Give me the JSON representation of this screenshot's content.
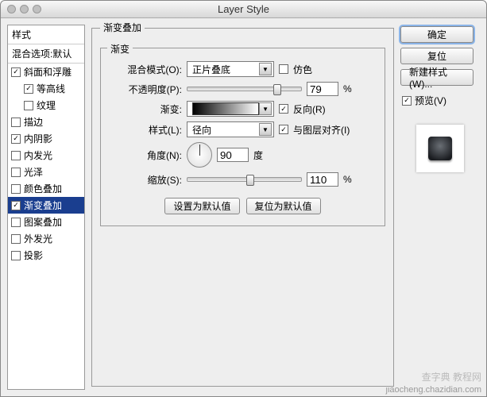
{
  "window": {
    "title": "Layer Style"
  },
  "left": {
    "header1": "样式",
    "header2": "混合选项:默认",
    "items": [
      {
        "label": "斜面和浮雕",
        "checked": true,
        "sub": false
      },
      {
        "label": "等高线",
        "checked": true,
        "sub": true
      },
      {
        "label": "纹理",
        "checked": false,
        "sub": true
      },
      {
        "label": "描边",
        "checked": false,
        "sub": false
      },
      {
        "label": "内阴影",
        "checked": true,
        "sub": false
      },
      {
        "label": "内发光",
        "checked": false,
        "sub": false
      },
      {
        "label": "光泽",
        "checked": false,
        "sub": false
      },
      {
        "label": "颜色叠加",
        "checked": false,
        "sub": false
      },
      {
        "label": "渐变叠加",
        "checked": true,
        "sub": false,
        "selected": true
      },
      {
        "label": "图案叠加",
        "checked": false,
        "sub": false
      },
      {
        "label": "外发光",
        "checked": false,
        "sub": false
      },
      {
        "label": "投影",
        "checked": false,
        "sub": false
      }
    ]
  },
  "center": {
    "groupTitle": "渐变叠加",
    "fieldsetTitle": "渐变",
    "blendMode": {
      "label": "混合模式(O):",
      "value": "正片叠底"
    },
    "dither": {
      "label": "仿色",
      "checked": false
    },
    "opacity": {
      "label": "不透明度(P):",
      "value": "79",
      "unit": "%"
    },
    "gradient": {
      "label": "渐变:"
    },
    "reverse": {
      "label": "反向(R)",
      "checked": true
    },
    "style": {
      "label": "样式(L):",
      "value": "径向"
    },
    "alignWithLayer": {
      "label": "与图层对齐(I)",
      "checked": true
    },
    "angle": {
      "label": "角度(N):",
      "value": "90",
      "unit": "度"
    },
    "scale": {
      "label": "缩放(S):",
      "value": "110",
      "unit": "%"
    },
    "defaultsBtn": "设置为默认值",
    "resetBtn": "复位为默认值"
  },
  "right": {
    "ok": "确定",
    "cancel": "复位",
    "newStyle": "新建样式(W)...",
    "preview": "预览(V)",
    "previewChecked": true
  },
  "watermark": {
    "line1": "查字典 教程网",
    "line2": "jiaocheng.chazidian.com"
  }
}
